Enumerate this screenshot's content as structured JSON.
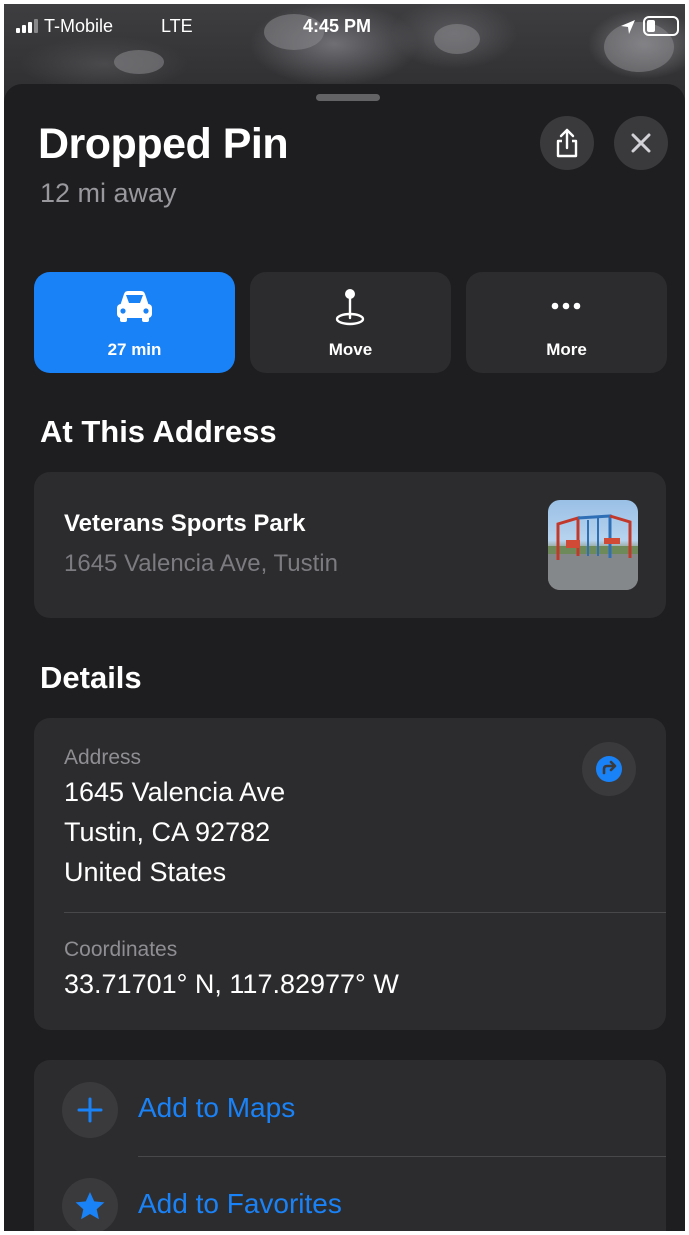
{
  "status_bar": {
    "carrier": "T-Mobile",
    "network": "LTE",
    "time": "4:45 PM",
    "battery_level": 0.3
  },
  "sheet": {
    "title": "Dropped Pin",
    "subtitle": "12 mi away",
    "share_icon": "share-icon",
    "close_icon": "close-icon"
  },
  "actions": [
    {
      "label": "27 min",
      "icon": "car-icon",
      "primary": true
    },
    {
      "label": "Move",
      "icon": "pin-icon",
      "primary": false
    },
    {
      "label": "More",
      "icon": "ellipsis-icon",
      "primary": false
    }
  ],
  "at_address": {
    "heading": "At This Address",
    "place_name": "Veterans Sports Park",
    "place_address": "1645 Valencia Ave, Tustin"
  },
  "details": {
    "heading": "Details",
    "address_label": "Address",
    "address_lines": [
      "1645 Valencia Ave",
      "Tustin, CA  92782",
      "United States"
    ],
    "coordinates_label": "Coordinates",
    "coordinates_value": "33.71701° N, 117.82977° W"
  },
  "actions_list": [
    {
      "label": "Add to Maps",
      "icon": "plus-icon"
    },
    {
      "label": "Add to Favorites",
      "icon": "star-icon"
    }
  ],
  "colors": {
    "accent": "#1a82f7",
    "sheet_bg": "#1e1e20",
    "card_bg": "#2c2c2e",
    "secondary_text": "#98989d"
  }
}
